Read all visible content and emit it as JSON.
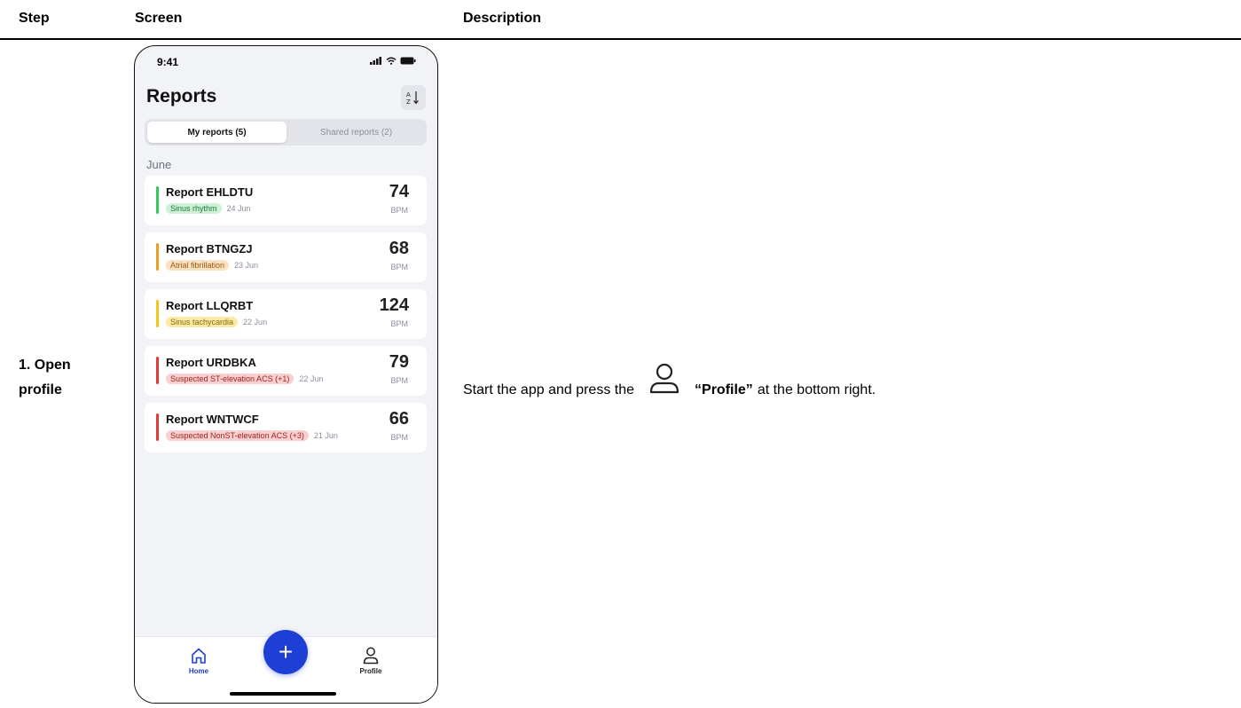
{
  "table": {
    "headers": {
      "step": "Step",
      "screen": "Screen",
      "description": "Description"
    }
  },
  "step": {
    "label_line1": "1. Open",
    "label_line2": "profile"
  },
  "description": {
    "before": "Start the app and press the",
    "emphasis": "“Profile”",
    "after": "at the bottom right.",
    "icon": "profile-icon"
  },
  "phone": {
    "status": {
      "time": "9:41"
    },
    "title": "Reports",
    "sort_icon_text": "A↓Z",
    "segments": {
      "active": "My reports (5)",
      "inactive": "Shared reports (2)"
    },
    "month": "June",
    "reports": [
      {
        "title": "Report EHLDTU",
        "tag": "Sinus rhythm",
        "date": "24 Jun",
        "bpm": "74",
        "unit": "BPM",
        "color": "#34c759",
        "tag_bg": "#cdf1d6",
        "tag_fg": "#1e7a35"
      },
      {
        "title": "Report BTNGZJ",
        "tag": "Atrial fibrillation",
        "date": "23 Jun",
        "bpm": "68",
        "unit": "BPM",
        "color": "#f29b1d",
        "tag_bg": "#fbe1c2",
        "tag_fg": "#9a5a0a"
      },
      {
        "title": "Report LLQRBT",
        "tag": "Sinus tachycardia",
        "date": "22 Jun",
        "bpm": "124",
        "unit": "BPM",
        "color": "#f5c518",
        "tag_bg": "#fbeaa5",
        "tag_fg": "#86690a"
      },
      {
        "title": "Report URDBKA",
        "tag": "Suspected ST-elevation ACS (+1)",
        "date": "22 Jun",
        "bpm": "79",
        "unit": "BPM",
        "color": "#e53935",
        "tag_bg": "#f9d0d0",
        "tag_fg": "#a32020"
      },
      {
        "title": "Report WNTWCF",
        "tag": "Suspected NonST-elevation ACS (+3)",
        "date": "21 Jun",
        "bpm": "66",
        "unit": "BPM",
        "color": "#e53935",
        "tag_bg": "#f9d0d0",
        "tag_fg": "#a32020"
      }
    ],
    "tabs": {
      "home": "Home",
      "add": "+",
      "profile": "Profile"
    },
    "accent": "#1d3fd6"
  }
}
